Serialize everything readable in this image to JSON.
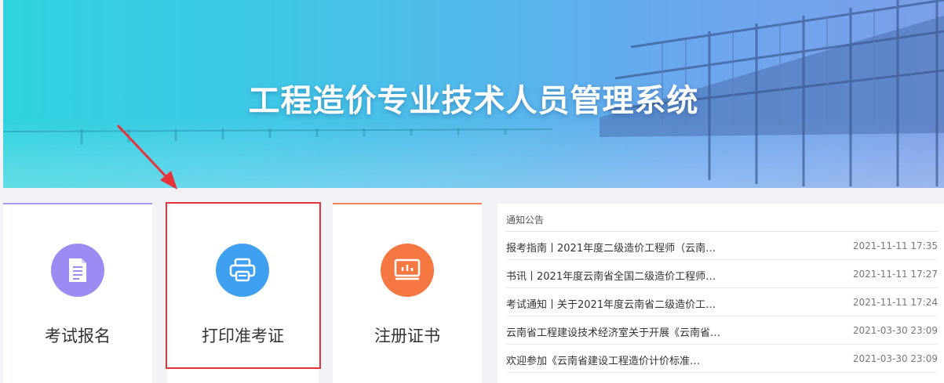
{
  "banner": {
    "title": "工程造价专业技术人员管理系统"
  },
  "cards": [
    {
      "label": "考试报名",
      "icon": "document-icon",
      "color": "#9b8cf3"
    },
    {
      "label": "打印准考证",
      "icon": "printer-icon",
      "color": "#3fa0f2"
    },
    {
      "label": "注册证书",
      "icon": "certificate-icon",
      "color": "#f57843"
    }
  ],
  "notice": {
    "title": "通知公告",
    "items": [
      {
        "title": "报考指南丨2021年度二级造价工程师（云南…",
        "date": "2021-11-11 17:35"
      },
      {
        "title": "书讯丨2021年度云南省全国二级造价工程师…",
        "date": "2021-11-11 17:27"
      },
      {
        "title": "考试通知丨关于2021年度云南省二级造价工…",
        "date": "2021-11-11 17:24"
      },
      {
        "title": "云南省工程建设技术经济室关于开展《云南省…",
        "date": "2021-03-30 23:09"
      },
      {
        "title": "欢迎参加《云南省建设工程造价计价标准…",
        "date": "2021-03-30 23:09"
      }
    ]
  },
  "annotation": {
    "arrow_color": "#e5333a",
    "highlight_color": "#e5333a"
  }
}
